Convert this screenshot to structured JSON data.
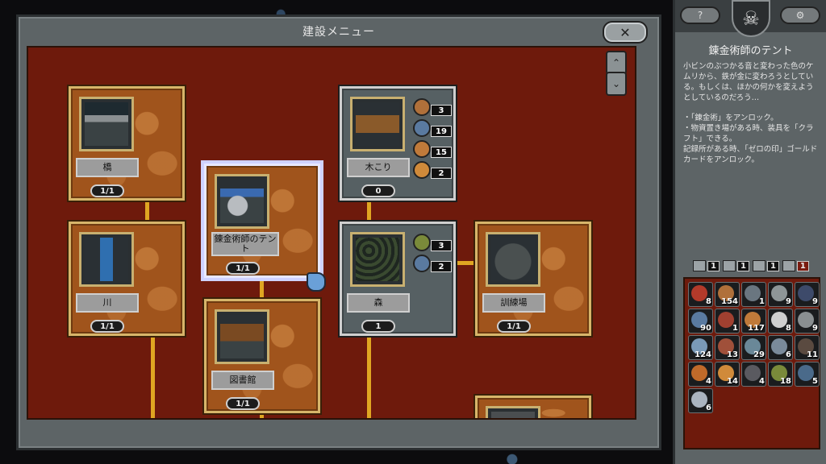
{
  "dialog": {
    "title": "建設メニュー",
    "close_label": "✕",
    "scroll_up": "⌃",
    "scroll_down": "⌄"
  },
  "cards": {
    "bridge": {
      "label": "橋",
      "count": "1/1"
    },
    "river": {
      "label": "川",
      "count": "1/1"
    },
    "alchemist_tent": {
      "label": "錬金術師のテント",
      "count": "1/1"
    },
    "library": {
      "label": "図書館",
      "count": "1/1"
    },
    "woodcutter": {
      "label": "木こり",
      "count": "0",
      "costs": [
        "3",
        "19",
        "15",
        "2"
      ]
    },
    "forest": {
      "label": "森",
      "count": "1",
      "costs": [
        "3",
        "2"
      ]
    },
    "training_ground": {
      "label": "訓練場",
      "count": "1/1"
    }
  },
  "side": {
    "help_label": "?",
    "settings_label": "⚙",
    "selected_title": "錬金術師のテント",
    "description": "小ビンのぶつかる音と変わった色のケムリから、鉄が金に変わろうとしている。もしくは、ほかの何かを変えようとしているのだろう…",
    "effects": [
      "・「錬金術」をアンロック。",
      "・物資置き場がある時、装具を「クラフト」できる。",
      "記録所がある時、「ゼロの印」ゴールドカードをアンロック。"
    ],
    "stats": [
      "1",
      "1",
      "1",
      "1"
    ]
  },
  "inventory": [
    {
      "icon": "orb-red-icon",
      "count": "8",
      "color": "#b33a2a"
    },
    {
      "icon": "plank-icon",
      "count": "154",
      "color": "#b0703a"
    },
    {
      "icon": "metal-icon",
      "count": "1",
      "color": "#6a7680"
    },
    {
      "icon": "stone-icon",
      "count": "9",
      "color": "#8e9597"
    },
    {
      "icon": "shard-icon",
      "count": "9",
      "color": "#3d4a6a"
    },
    {
      "icon": "orb-blue-icon",
      "count": "90",
      "color": "#5a7aa0"
    },
    {
      "icon": "feather-icon",
      "count": "1",
      "color": "#a04030"
    },
    {
      "icon": "ration-icon",
      "count": "117",
      "color": "#c07a3a"
    },
    {
      "icon": "skull-icon",
      "count": "8",
      "color": "#cfcfcf"
    },
    {
      "icon": "shield-icon",
      "count": "9",
      "color": "#8a8f91"
    },
    {
      "icon": "eye-icon",
      "count": "124",
      "color": "#7a9ab8"
    },
    {
      "icon": "shell-icon",
      "count": "13",
      "color": "#a0503a"
    },
    {
      "icon": "wheel-icon",
      "count": "29",
      "color": "#6a8898"
    },
    {
      "icon": "bone-icon",
      "count": "6",
      "color": "#7a8a9a"
    },
    {
      "icon": "claw-icon",
      "count": "11",
      "color": "#5a4a40"
    },
    {
      "icon": "torch-icon",
      "count": "4",
      "color": "#c06a2a"
    },
    {
      "icon": "bread-icon",
      "count": "14",
      "color": "#d08a3a"
    },
    {
      "icon": "rock-icon",
      "count": "4",
      "color": "#5a5a60"
    },
    {
      "icon": "moss-icon",
      "count": "18",
      "color": "#7a8a3a"
    },
    {
      "icon": "spiral-icon",
      "count": "5",
      "color": "#4a6a8a"
    },
    {
      "icon": "gear-orb-icon",
      "count": "6",
      "color": "#aab4c0"
    }
  ]
}
